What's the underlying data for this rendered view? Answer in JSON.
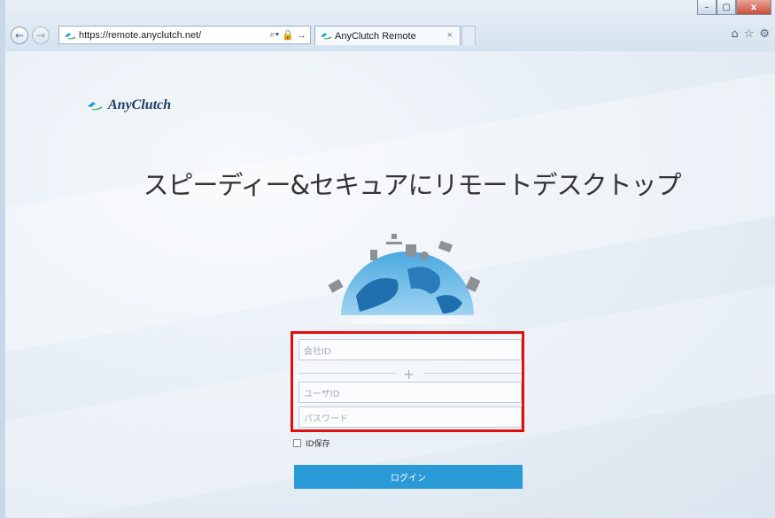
{
  "browser": {
    "url": "https://remote.anyclutch.net/",
    "tab_title": "AnyClutch Remote",
    "tab_close": "×",
    "address_tools": "⌕ ▾ 🔒 →",
    "window_buttons": {
      "minimize": "–",
      "maximize": "▢",
      "close": "x"
    },
    "toolbar_right_icons": [
      "home-icon",
      "star-icon",
      "gear-icon"
    ]
  },
  "page": {
    "logo_text": "AnyClutch",
    "headline": "スピーディー&セキュアにリモートデスクトップ",
    "form": {
      "company_id_placeholder": "会社ID",
      "divider_symbol": "+",
      "user_id_placeholder": "ユーザID",
      "password_placeholder": "パスワード",
      "remember_label": "ID保存",
      "remember_checked": false,
      "login_label": "ログイン"
    },
    "colors": {
      "login_button": "#2a9ad6",
      "highlight_border": "#e01010",
      "logo_text": "#1d3c64"
    }
  }
}
